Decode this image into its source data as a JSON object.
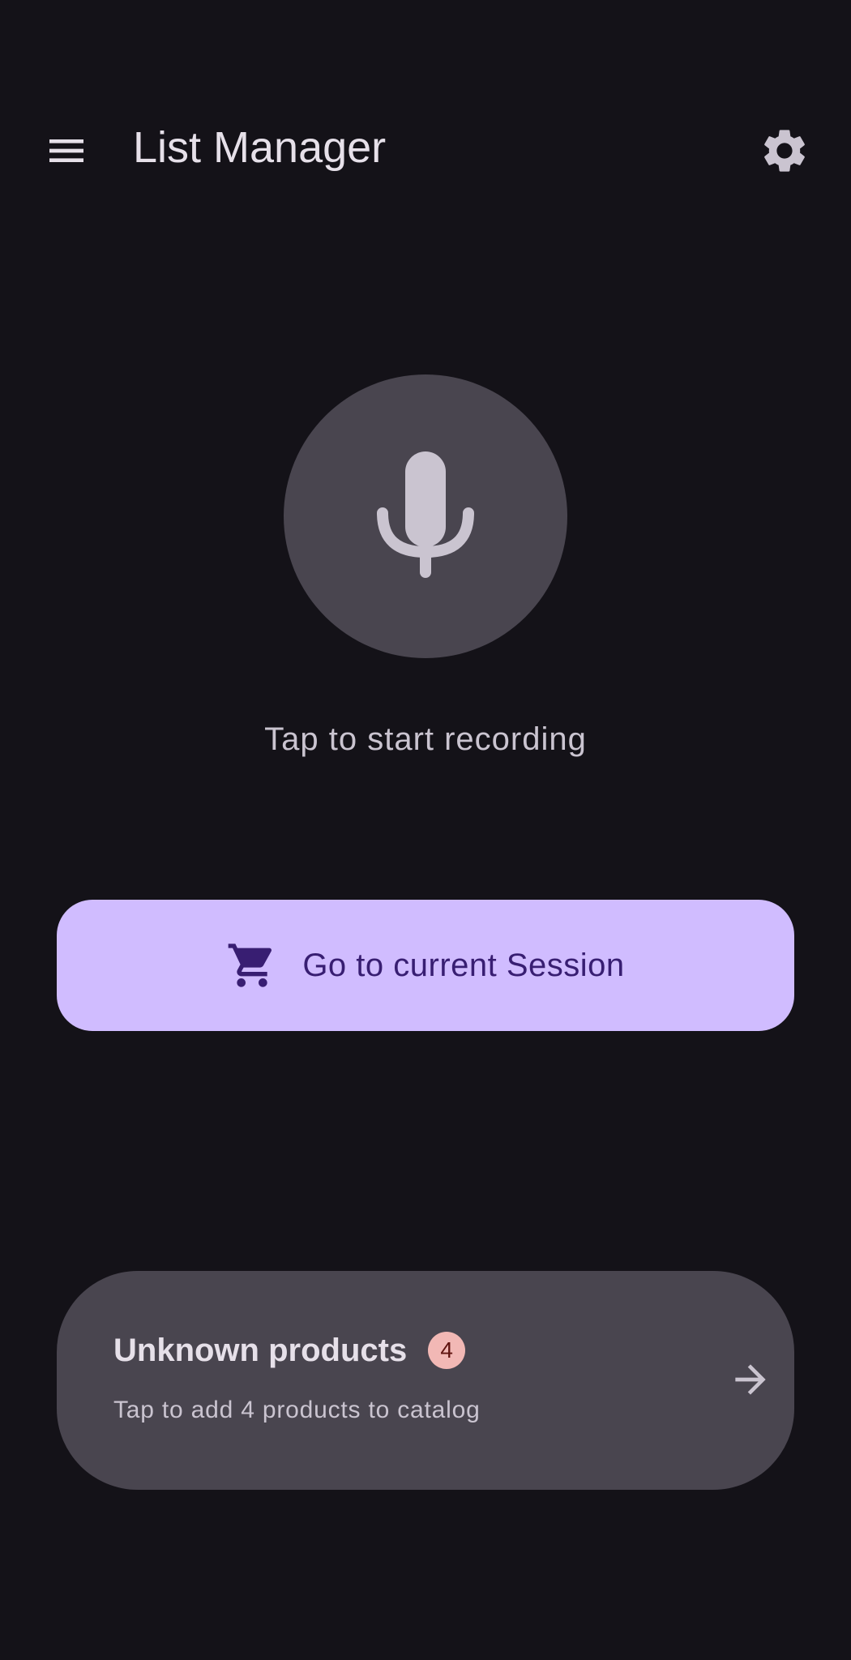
{
  "topbar": {
    "title": "List Manager",
    "menu_icon": "menu-icon",
    "settings_icon": "gear-icon"
  },
  "recorder": {
    "icon": "microphone-icon",
    "label": "Tap to start recording"
  },
  "session_button": {
    "icon": "shopping-cart-icon",
    "label": "Go to current Session"
  },
  "unknown_products": {
    "title": "Unknown products",
    "badge_count": "4",
    "subtitle": "Tap to add 4 products to catalog",
    "icon": "arrow-right-icon"
  },
  "colors": {
    "background": "#141218",
    "surface_variant": "#49454F",
    "primary_container": "#D0BCFF",
    "on_primary_container": "#381E72",
    "error_container": "#F2B8B5",
    "on_surface": "#E6E0E9",
    "on_surface_variant": "#CAC4D0"
  }
}
